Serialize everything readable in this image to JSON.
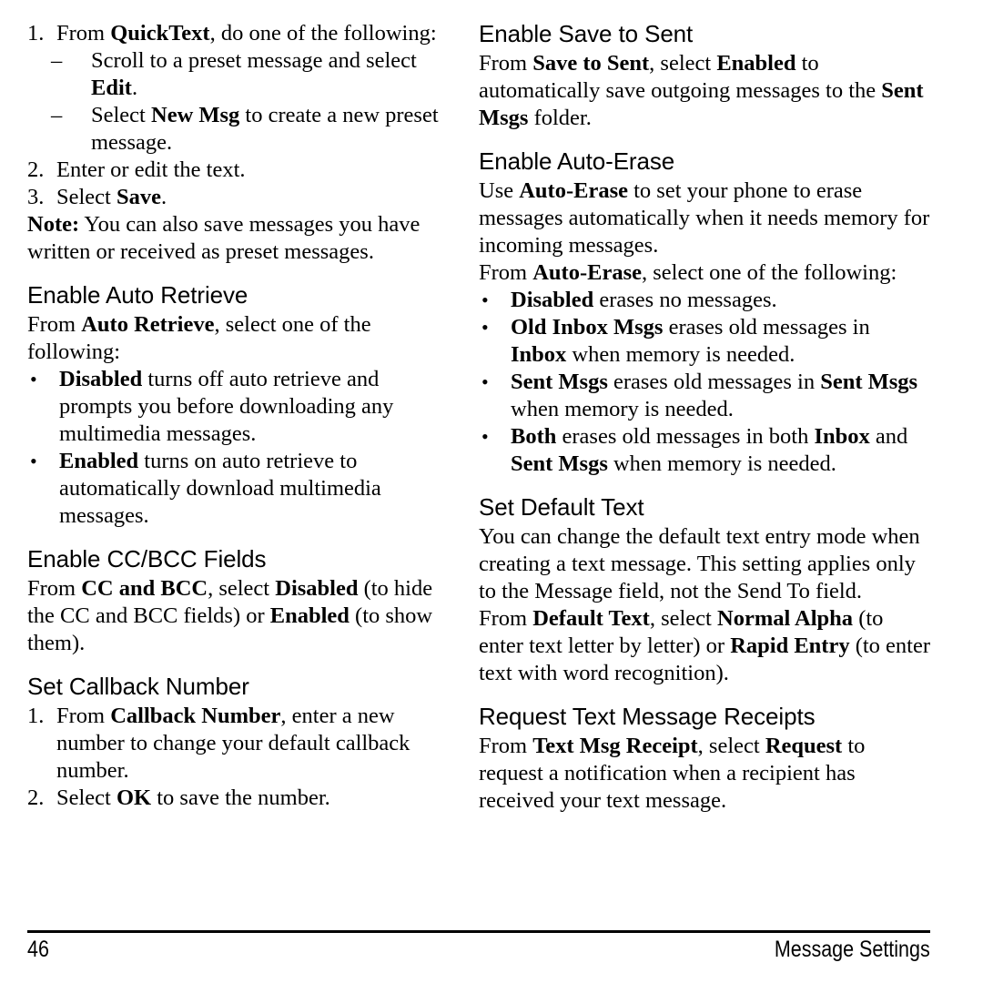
{
  "document": {
    "page_number": "46",
    "footer_title": "Message Settings",
    "text_color": "#000000",
    "background_color": "#ffffff"
  },
  "left_column": {
    "blocks": [
      {
        "type": "numbered-item",
        "marker": "1.",
        "runs": [
          {
            "text": "From ",
            "bold": false
          },
          {
            "text": "QuickText",
            "bold": true
          },
          {
            "text": ", do one of the following:",
            "bold": false
          }
        ]
      },
      {
        "type": "dash-item",
        "marker": "–",
        "runs": [
          {
            "text": "Scroll to a preset message and select ",
            "bold": false
          },
          {
            "text": "Edit",
            "bold": true
          },
          {
            "text": ".",
            "bold": false
          }
        ]
      },
      {
        "type": "dash-item",
        "marker": "–",
        "runs": [
          {
            "text": "Select ",
            "bold": false
          },
          {
            "text": "New Msg",
            "bold": true
          },
          {
            "text": " to create a new preset message.",
            "bold": false
          }
        ]
      },
      {
        "type": "numbered-item",
        "marker": "2.",
        "runs": [
          {
            "text": "Enter or edit the text.",
            "bold": false
          }
        ]
      },
      {
        "type": "numbered-item",
        "marker": "3.",
        "runs": [
          {
            "text": "Select ",
            "bold": false
          },
          {
            "text": "Save",
            "bold": true
          },
          {
            "text": ".",
            "bold": false
          }
        ]
      },
      {
        "type": "paragraph",
        "runs": [
          {
            "text": "Note:",
            "bold": true
          },
          {
            "text": " You can also save messages you have written or received as preset messages.",
            "bold": false
          }
        ]
      },
      {
        "type": "heading",
        "runs": [
          {
            "text": "Enable Auto Retrieve",
            "bold": false
          }
        ]
      },
      {
        "type": "paragraph",
        "runs": [
          {
            "text": "From ",
            "bold": false
          },
          {
            "text": "Auto Retrieve",
            "bold": true
          },
          {
            "text": ", select one of the following:",
            "bold": false
          }
        ]
      },
      {
        "type": "bullet-item",
        "marker": "•",
        "runs": [
          {
            "text": "Disabled",
            "bold": true
          },
          {
            "text": " turns off auto retrieve and prompts you before downloading any multimedia messages.",
            "bold": false
          }
        ]
      },
      {
        "type": "bullet-item",
        "marker": "•",
        "runs": [
          {
            "text": "Enabled",
            "bold": true
          },
          {
            "text": " turns on auto retrieve to automatically download multimedia messages.",
            "bold": false
          }
        ]
      },
      {
        "type": "heading",
        "runs": [
          {
            "text": "Enable CC/BCC Fields",
            "bold": false
          }
        ]
      },
      {
        "type": "paragraph",
        "runs": [
          {
            "text": "From ",
            "bold": false
          },
          {
            "text": "CC and BCC",
            "bold": true
          },
          {
            "text": ", select ",
            "bold": false
          },
          {
            "text": "Disabled",
            "bold": true
          },
          {
            "text": " (to hide the CC and BCC fields) or ",
            "bold": false
          },
          {
            "text": "Enabled",
            "bold": true
          },
          {
            "text": " (to show them).",
            "bold": false
          }
        ]
      },
      {
        "type": "heading",
        "runs": [
          {
            "text": "Set Callback Number",
            "bold": false
          }
        ]
      },
      {
        "type": "numbered-item",
        "marker": "1.",
        "runs": [
          {
            "text": "From ",
            "bold": false
          },
          {
            "text": "Callback Number",
            "bold": true
          },
          {
            "text": ", enter a new number to change your default callback number.",
            "bold": false
          }
        ]
      },
      {
        "type": "numbered-item",
        "marker": "2.",
        "runs": [
          {
            "text": "Select ",
            "bold": false
          },
          {
            "text": "OK",
            "bold": true
          },
          {
            "text": " to save the number.",
            "bold": false
          }
        ]
      }
    ]
  },
  "right_column": {
    "blocks": [
      {
        "type": "heading",
        "runs": [
          {
            "text": "Enable Save to Sent",
            "bold": false
          }
        ]
      },
      {
        "type": "paragraph",
        "runs": [
          {
            "text": "From ",
            "bold": false
          },
          {
            "text": "Save to Sent",
            "bold": true
          },
          {
            "text": ", select ",
            "bold": false
          },
          {
            "text": "Enabled",
            "bold": true
          },
          {
            "text": " to automatically save outgoing messages to the ",
            "bold": false
          },
          {
            "text": "Sent Msgs",
            "bold": true
          },
          {
            "text": " folder.",
            "bold": false
          }
        ]
      },
      {
        "type": "heading",
        "runs": [
          {
            "text": "Enable Auto-Erase",
            "bold": false
          }
        ]
      },
      {
        "type": "paragraph",
        "runs": [
          {
            "text": "Use ",
            "bold": false
          },
          {
            "text": "Auto-Erase",
            "bold": true
          },
          {
            "text": " to set your phone to erase messages automatically when it needs memory for incoming messages.",
            "bold": false
          }
        ]
      },
      {
        "type": "paragraph",
        "runs": [
          {
            "text": "From ",
            "bold": false
          },
          {
            "text": "Auto-Erase",
            "bold": true
          },
          {
            "text": ", select one of the following:",
            "bold": false
          }
        ]
      },
      {
        "type": "bullet-item",
        "marker": "•",
        "runs": [
          {
            "text": "Disabled",
            "bold": true
          },
          {
            "text": " erases no messages.",
            "bold": false
          }
        ]
      },
      {
        "type": "bullet-item",
        "marker": "•",
        "runs": [
          {
            "text": "Old Inbox Msgs",
            "bold": true
          },
          {
            "text": " erases old messages in ",
            "bold": false
          },
          {
            "text": "Inbox",
            "bold": true
          },
          {
            "text": " when memory is needed.",
            "bold": false
          }
        ]
      },
      {
        "type": "bullet-item",
        "marker": "•",
        "runs": [
          {
            "text": "Sent Msgs",
            "bold": true
          },
          {
            "text": " erases old messages in ",
            "bold": false
          },
          {
            "text": "Sent Msgs",
            "bold": true
          },
          {
            "text": " when memory is needed.",
            "bold": false
          }
        ]
      },
      {
        "type": "bullet-item",
        "marker": "•",
        "runs": [
          {
            "text": "Both",
            "bold": true
          },
          {
            "text": " erases old messages in both ",
            "bold": false
          },
          {
            "text": "Inbox",
            "bold": true
          },
          {
            "text": " and ",
            "bold": false
          },
          {
            "text": "Sent Msgs",
            "bold": true
          },
          {
            "text": " when memory is needed.",
            "bold": false
          }
        ]
      },
      {
        "type": "heading",
        "runs": [
          {
            "text": "Set Default Text",
            "bold": false
          }
        ]
      },
      {
        "type": "paragraph",
        "runs": [
          {
            "text": "You can change the default text entry mode when creating a text message. This setting applies only to the Message field, not the Send To field.",
            "bold": false
          }
        ]
      },
      {
        "type": "paragraph",
        "runs": [
          {
            "text": "From ",
            "bold": false
          },
          {
            "text": "Default Text",
            "bold": true
          },
          {
            "text": ", select ",
            "bold": false
          },
          {
            "text": "Normal Alpha",
            "bold": true
          },
          {
            "text": " (to enter text letter by letter) or ",
            "bold": false
          },
          {
            "text": "Rapid Entry",
            "bold": true
          },
          {
            "text": " (to enter text with word recognition).",
            "bold": false
          }
        ]
      },
      {
        "type": "heading",
        "runs": [
          {
            "text": "Request Text Message Receipts",
            "bold": false
          }
        ]
      },
      {
        "type": "paragraph",
        "runs": [
          {
            "text": "From ",
            "bold": false
          },
          {
            "text": "Text Msg Receipt",
            "bold": true
          },
          {
            "text": ", select ",
            "bold": false
          },
          {
            "text": "Request",
            "bold": true
          },
          {
            "text": " to request a notification when a recipient has received your text message.",
            "bold": false
          }
        ]
      }
    ]
  }
}
